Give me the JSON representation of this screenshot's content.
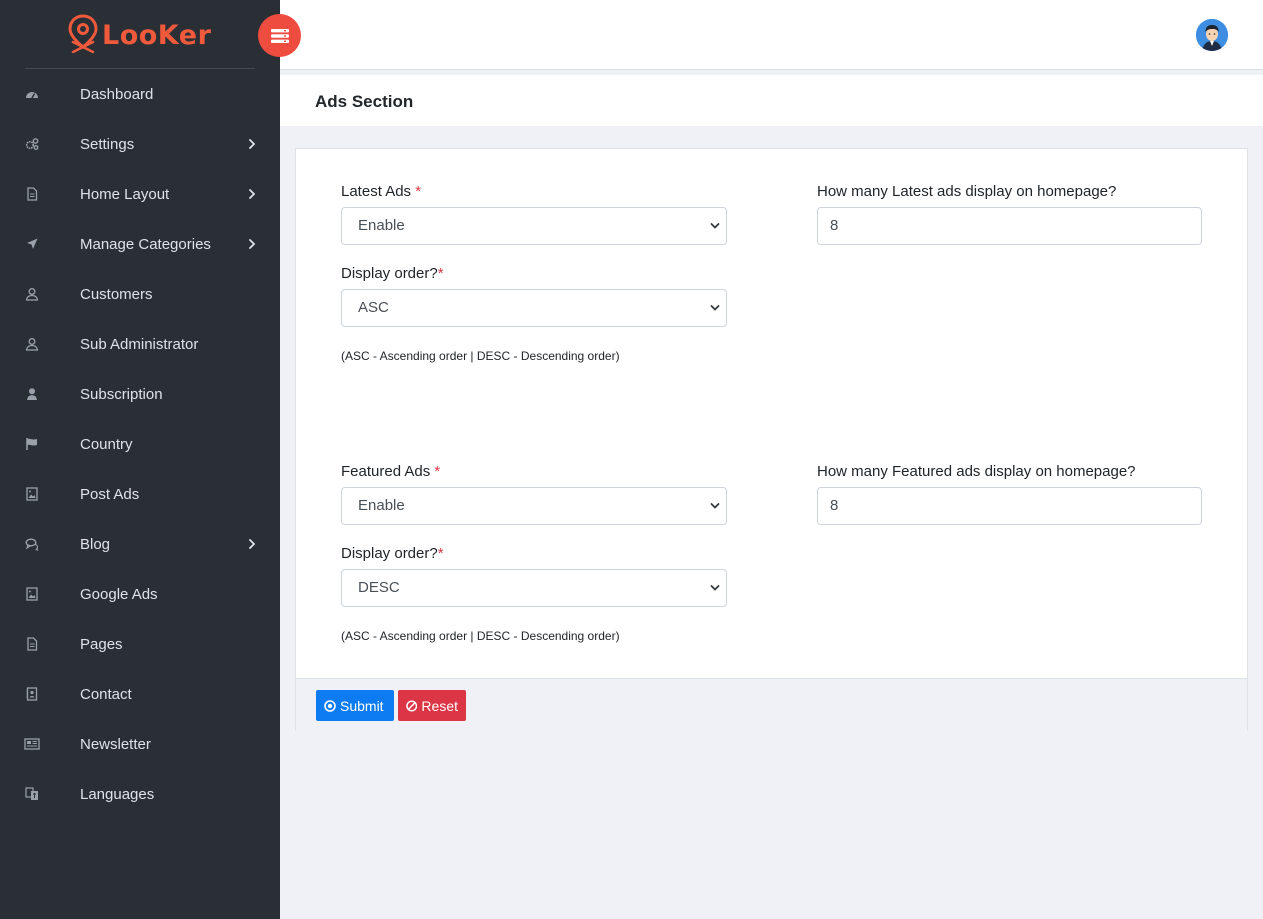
{
  "brand": {
    "name": "LooKer",
    "color": "#ef5a3c"
  },
  "sidebar": {
    "items": [
      {
        "label": "Dashboard",
        "icon": "dashboard-icon",
        "has_children": false
      },
      {
        "label": "Settings",
        "icon": "cogs-icon",
        "has_children": true
      },
      {
        "label": "Home Layout",
        "icon": "file-icon",
        "has_children": true
      },
      {
        "label": "Manage Categories",
        "icon": "location-arrow-icon",
        "has_children": true
      },
      {
        "label": "Customers",
        "icon": "user-icon",
        "has_children": false
      },
      {
        "label": "Sub Administrator",
        "icon": "user-icon",
        "has_children": false
      },
      {
        "label": "Subscription",
        "icon": "user-solid-icon",
        "has_children": false
      },
      {
        "label": "Country",
        "icon": "flag-icon",
        "has_children": false
      },
      {
        "label": "Post Ads",
        "icon": "image-icon",
        "has_children": false
      },
      {
        "label": "Blog",
        "icon": "comments-icon",
        "has_children": true
      },
      {
        "label": "Google Ads",
        "icon": "image-icon",
        "has_children": false
      },
      {
        "label": "Pages",
        "icon": "file-icon",
        "has_children": false
      },
      {
        "label": "Contact",
        "icon": "contact-card-icon",
        "has_children": false
      },
      {
        "label": "Newsletter",
        "icon": "newspaper-icon",
        "has_children": false
      },
      {
        "label": "Languages",
        "icon": "language-icon",
        "has_children": false
      }
    ]
  },
  "header": {
    "title": "Ads Section"
  },
  "form": {
    "latest": {
      "label": "Latest Ads",
      "required_mark": "*",
      "value": "Enable",
      "count_label": "How many Latest ads display on homepage?",
      "count_value": "8",
      "order_label": "Display order?",
      "order_required_mark": "*",
      "order_value": "ASC",
      "hint": "(ASC - Ascending order | DESC - Descending order)"
    },
    "featured": {
      "label": "Featured Ads",
      "required_mark": "*",
      "value": "Enable",
      "count_label": "How many Featured ads display on homepage?",
      "count_value": "8",
      "order_label": "Display order?",
      "order_required_mark": "*",
      "order_value": "DESC",
      "hint": "(ASC - Ascending order | DESC - Descending order)"
    }
  },
  "actions": {
    "submit_label": "Submit",
    "reset_label": "Reset"
  },
  "colors": {
    "sidebar_bg": "#2a2f36",
    "toggle": "#ee4c3f",
    "submit": "#0d7cf2",
    "reset": "#dc3545"
  }
}
